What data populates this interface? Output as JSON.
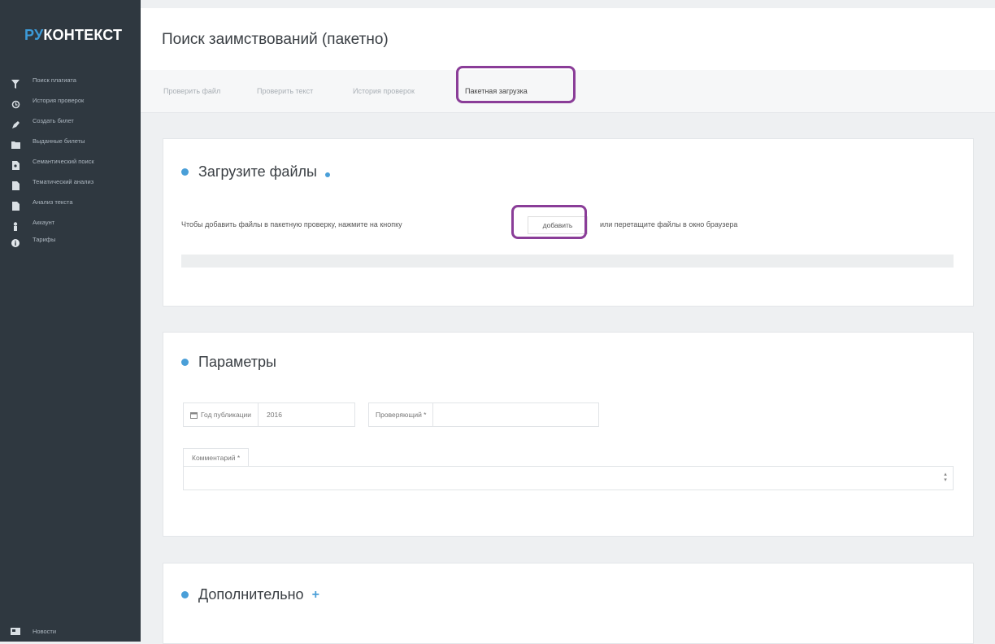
{
  "brand": {
    "prefix": "РУ",
    "suffix": "КОНТЕКСТ"
  },
  "sidebar": {
    "items": [
      {
        "label": "Поиск плагиата",
        "icon": "filter-icon"
      },
      {
        "label": "История проверок",
        "icon": "history-icon"
      },
      {
        "label": "Создать билет",
        "icon": "pencil-icon"
      },
      {
        "label": "Выданные билеты",
        "icon": "folder-icon"
      },
      {
        "label": "Семантический поиск",
        "icon": "document-search-icon"
      },
      {
        "label": "Тематический анализ",
        "icon": "document-icon"
      },
      {
        "label": "Анализ текста",
        "icon": "document-text-icon"
      },
      {
        "label": "Аккаунт",
        "icon": "user-icon"
      },
      {
        "label": "Тарифы",
        "icon": "info-icon"
      }
    ],
    "news": {
      "label": "Новости",
      "icon": "news-icon"
    }
  },
  "header": {
    "title": "Поиск заимствований (пакетно)"
  },
  "tabs": [
    {
      "label": "Проверить файл"
    },
    {
      "label": "Проверить текст"
    },
    {
      "label": "История проверок"
    },
    {
      "label": "Пакетная загрузка",
      "active": true
    }
  ],
  "upload": {
    "title": "Загрузите файлы",
    "text_before": "Чтобы добавить файлы в пакетную проверку, нажмите на кнопку",
    "button": "добавить",
    "text_after": "или перетащите файлы в окно браузера"
  },
  "params": {
    "title": "Параметры",
    "year_label": "Год публикации",
    "year_value": "2016",
    "reviewer_label": "Проверяющий *",
    "reviewer_value": "",
    "comment_label": "Комментарий *",
    "comment_value": ""
  },
  "extra": {
    "title": "Дополнительно"
  },
  "colors": {
    "accent": "#4a9fd8",
    "sidebar": "#2f3840",
    "highlight": "#8a3d98"
  }
}
